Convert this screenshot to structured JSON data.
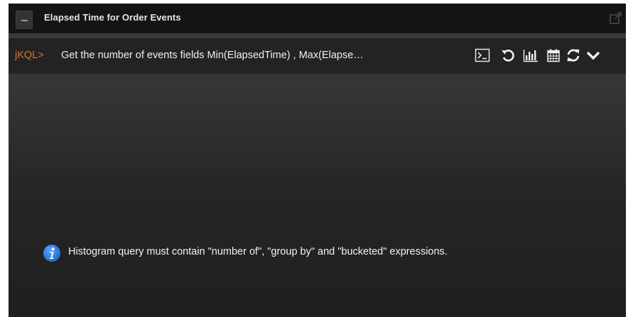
{
  "widget": {
    "title": "Elapsed Time for Order Events"
  },
  "query_bar": {
    "prompt": "jKQL>",
    "query": "Get the number of events fields Min(ElapsedTime) , Max(Elapse…",
    "tools": [
      "terminal-icon",
      "undo-icon",
      "bar-chart-icon",
      "calendar-icon",
      "refresh-icon",
      "chevron-down-icon"
    ]
  },
  "message": {
    "icon": "info-icon",
    "text": "Histogram query must contain \"number of\", \"group by\" and \"bucketed\" expressions."
  },
  "colors": {
    "prompt": "#d7752b",
    "info_icon": "#2f7fe0",
    "text": "#f0f0f0"
  }
}
